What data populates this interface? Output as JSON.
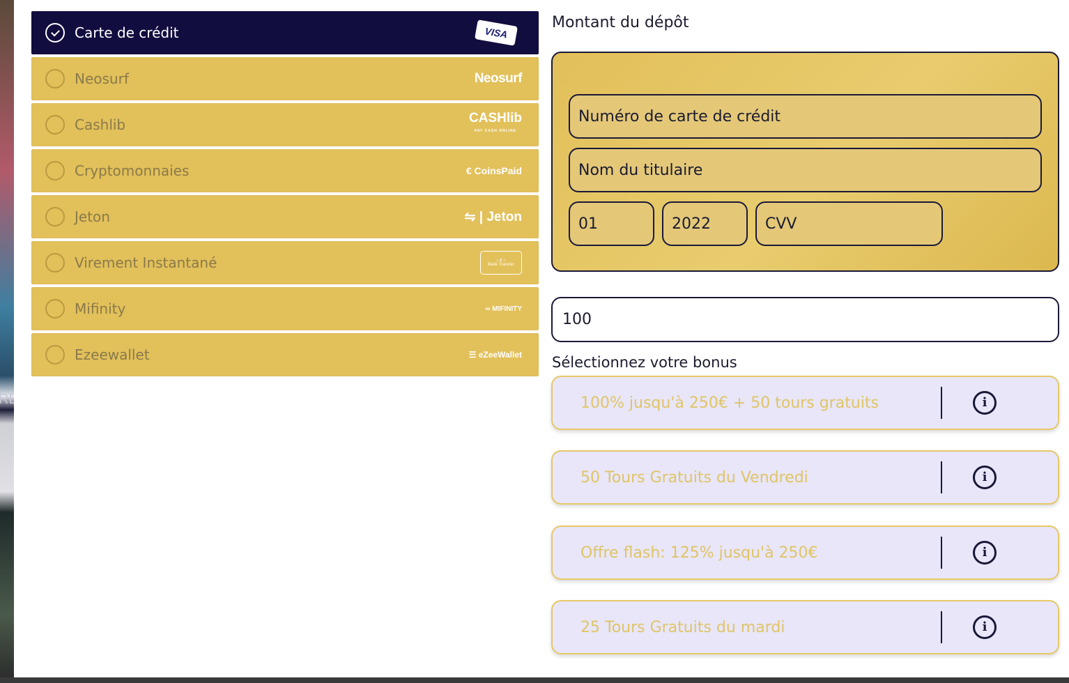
{
  "background": {
    "side_text": "RE"
  },
  "payment_methods": [
    {
      "label": "Carte de crédit",
      "selected": true,
      "logo": "VISA",
      "icon": "visa-card-icon"
    },
    {
      "label": "Neosurf",
      "selected": false,
      "logo": "Neosurf",
      "icon": "neosurf-logo"
    },
    {
      "label": "Cashlib",
      "selected": false,
      "logo": "CASHlib",
      "logo_sub": "PAY CASH ONLINE",
      "icon": "cashlib-logo"
    },
    {
      "label": "Cryptomonnaies",
      "selected": false,
      "logo": "€ CoinsPaid",
      "icon": "coinspaid-logo"
    },
    {
      "label": "Jeton",
      "selected": false,
      "logo": "⇋ | Jeton",
      "icon": "jeton-logo"
    },
    {
      "label": "Virement Instantané",
      "selected": false,
      "logo": "Bank Transfer",
      "icon": "bank-transfer-logo"
    },
    {
      "label": "Mifinity",
      "selected": false,
      "logo": "∞ MIFINITY",
      "icon": "mifinity-logo"
    },
    {
      "label": "Ezeewallet",
      "selected": false,
      "logo": "☰ eZeeWallet",
      "icon": "ezeewallet-logo"
    }
  ],
  "deposit": {
    "title": "Montant du dépôt",
    "card_number_placeholder": "Numéro de carte de crédit",
    "holder_placeholder": "Nom du titulaire",
    "month": "01",
    "year": "2022",
    "cvv_placeholder": "CVV",
    "amount": "100"
  },
  "bonus": {
    "title": "Sélectionnez votre bonus",
    "options": [
      "100% jusqu'à 250€ + 50 tours gratuits",
      "50 Tours Gratuits du Vendredi",
      "Offre flash: 125% jusqu'à 250€",
      "25 Tours Gratuits du mardi"
    ]
  },
  "colors": {
    "gold": "#e2c05a",
    "navy": "#120d3f",
    "bonus_bg": "#e8e6f8",
    "bonus_text": "#e0c466"
  }
}
